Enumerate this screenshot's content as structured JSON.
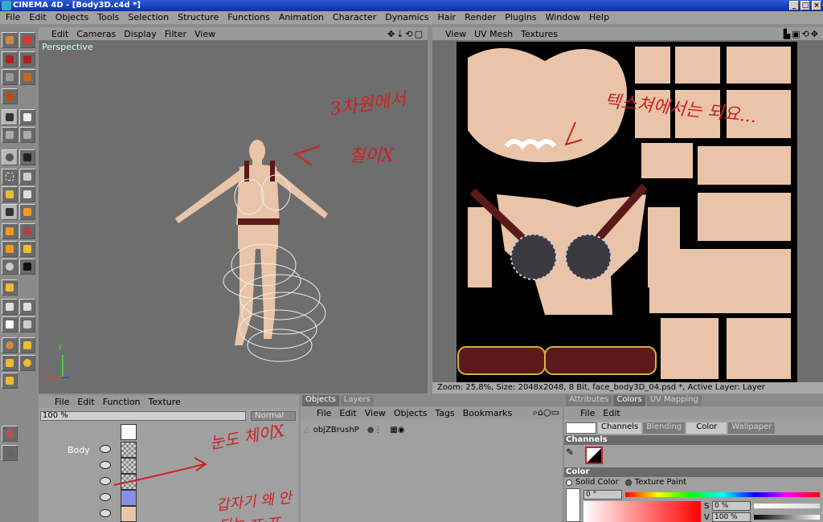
{
  "window": {
    "title": "CINEMA 4D - [Body3D.c4d *]"
  },
  "menubar": [
    "File",
    "Edit",
    "Objects",
    "Tools",
    "Selection",
    "Structure",
    "Functions",
    "Animation",
    "Character",
    "Dynamics",
    "Hair",
    "Render",
    "Plugins",
    "Window",
    "Help"
  ],
  "viewport_left": {
    "menu": [
      "Edit",
      "Cameras",
      "Display",
      "Filter",
      "View"
    ],
    "label": "Perspective",
    "axis": {
      "y": "y",
      "x": "x",
      "z": "z"
    },
    "annotation1": "3차원에서",
    "annotation2": "칠이X"
  },
  "viewport_right": {
    "menu": [
      "View",
      "UV Mesh",
      "Textures"
    ],
    "annotation": "텍스쳐에서는 되요...",
    "status": "Zoom: 25,8%, Size: 2048x2048, 8 Bit, face_body3D_04.psd *, Active Layer: Layer"
  },
  "layers_panel": {
    "menu": [
      "File",
      "Edit",
      "Function",
      "Texture"
    ],
    "zoom": "100 %",
    "blend": "Normal",
    "object": "Body",
    "annotation1": "눈도 체이X",
    "annotation2": "갑자기 왜 안되는 ㅠ-ㅠ"
  },
  "objects_panel": {
    "tabs": [
      "Objects",
      "Layers"
    ],
    "menu": [
      "File",
      "Edit",
      "View",
      "Objects",
      "Tags",
      "Bookmarks"
    ],
    "item": "objZBrushP"
  },
  "attributes_panel": {
    "tabs": [
      "Attributes",
      "Colors",
      "UV Mapping"
    ],
    "menu": [
      "File",
      "Edit"
    ],
    "subtabs": [
      "Channels",
      "Blending",
      "Color",
      "Wallpaper"
    ],
    "section_channels": "Channels",
    "section_color": "Color",
    "radio1": "Solid Color",
    "radio2": "Texture Paint",
    "hue": "0 °",
    "s_label": "S",
    "s_value": "0 %",
    "v_label": "V",
    "v_value": "100 %"
  },
  "colors": {
    "skin": "#e9c4a8",
    "annotation": "#cc2222",
    "belt": "#5a1a1a"
  }
}
